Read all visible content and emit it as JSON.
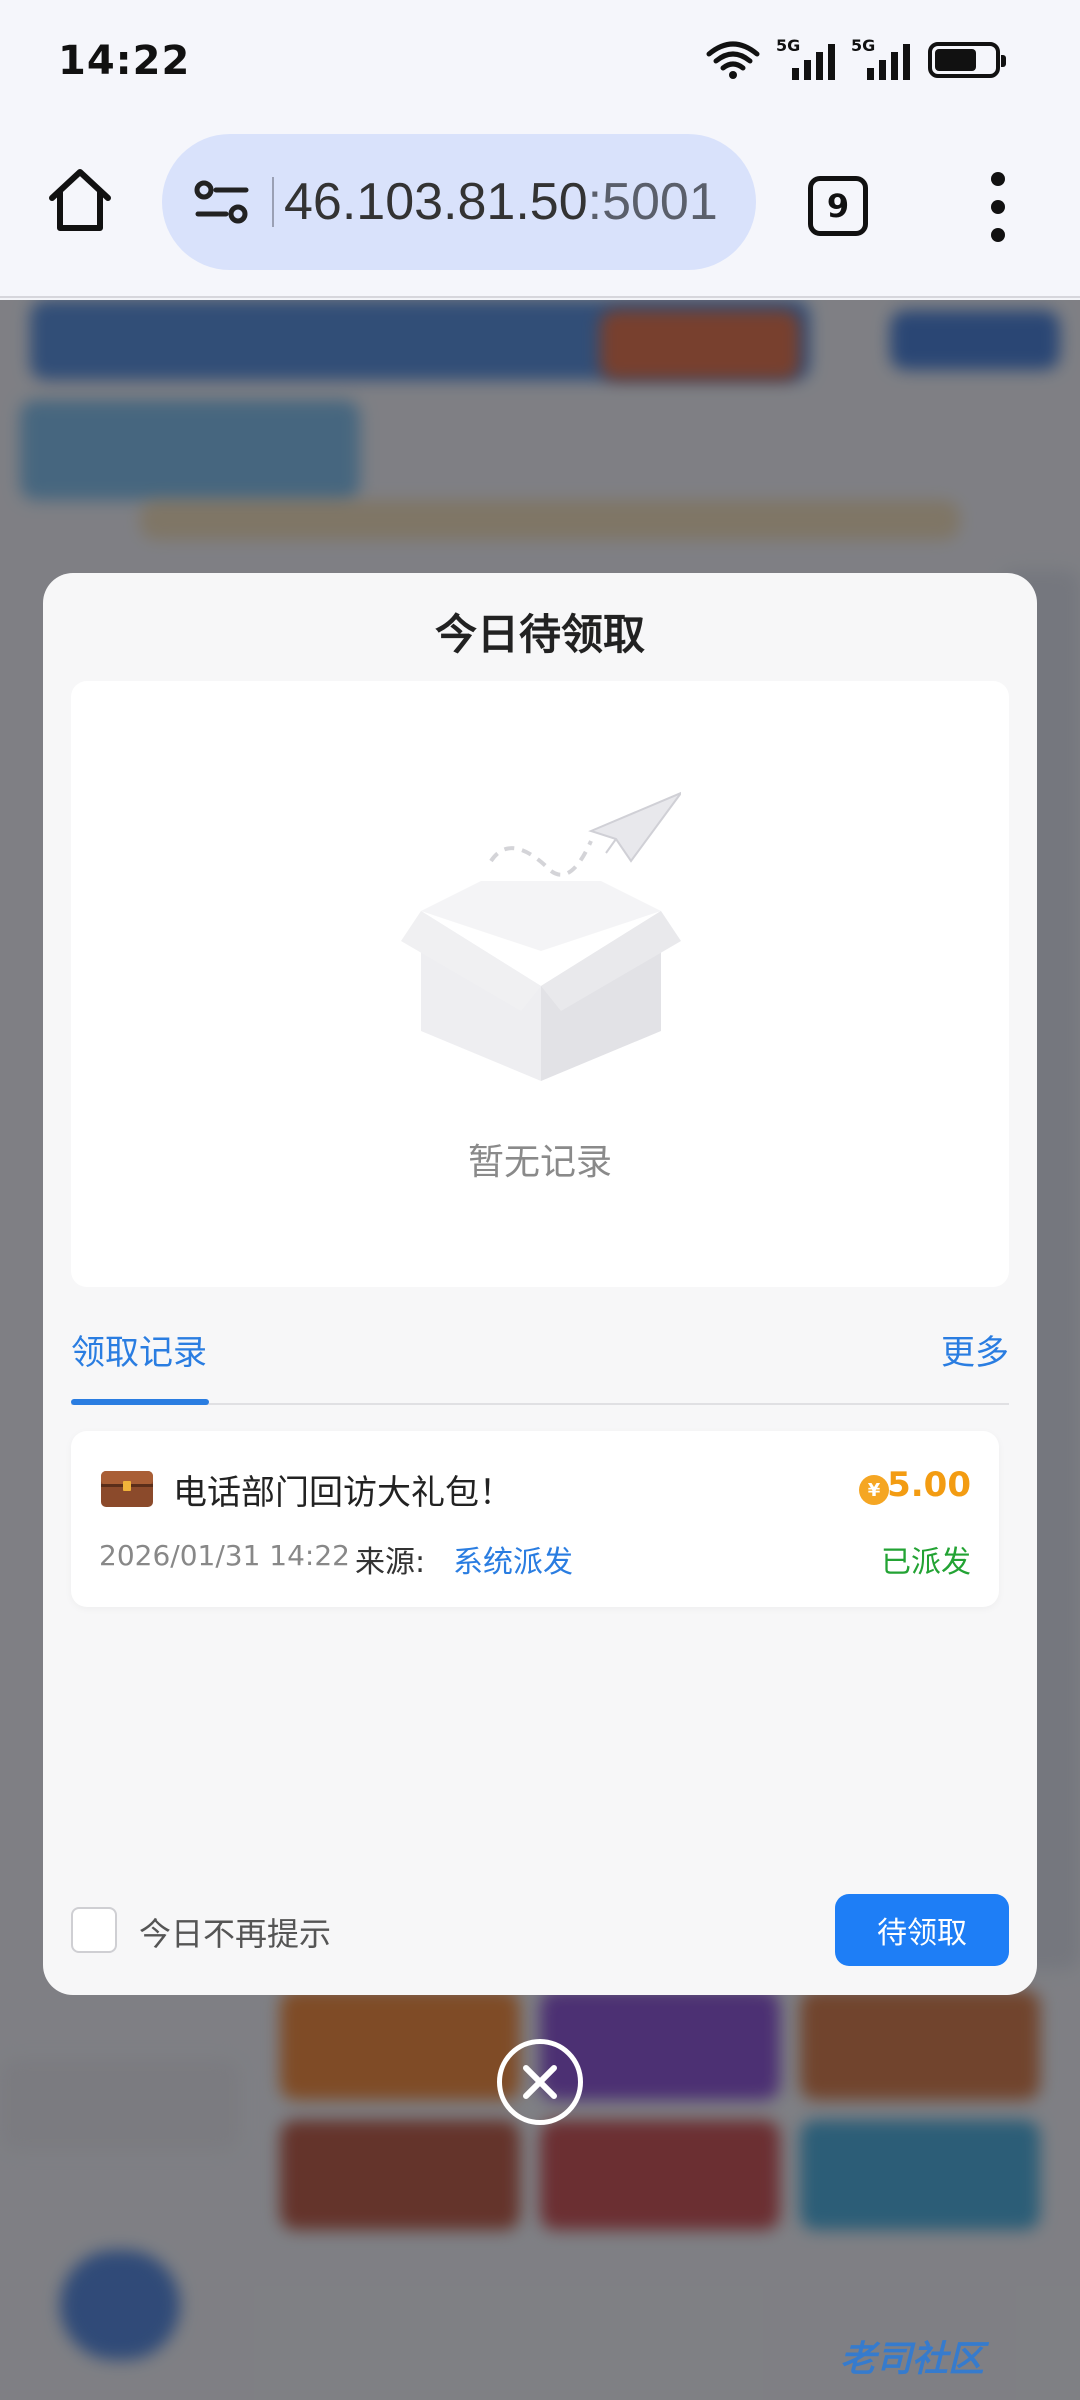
{
  "status_bar": {
    "time": "14:22",
    "signal1_label": "5G",
    "signal2_label": "5G"
  },
  "browser": {
    "url_host": "46.103.81.50",
    "url_port": ":5001",
    "tab_count": "9"
  },
  "modal": {
    "title": "今日待领取",
    "empty_text": "暂无记录",
    "tab_label": "领取记录",
    "more_label": "更多",
    "records": [
      {
        "title": "电话部门回访大礼包！",
        "amount": "5.00",
        "coin_symbol": "¥",
        "date": "2026/01/31 14:22",
        "source_label": "来源:",
        "source_value": "系统派发",
        "status": "已派发"
      }
    ],
    "dont_show_label": "今日不再提示",
    "claim_button": "待领取"
  },
  "watermark": "老司社区",
  "colors": {
    "accent": "#1e7ef6",
    "link": "#2a7de1",
    "amount": "#f39c12",
    "status_ok": "#23a334"
  }
}
